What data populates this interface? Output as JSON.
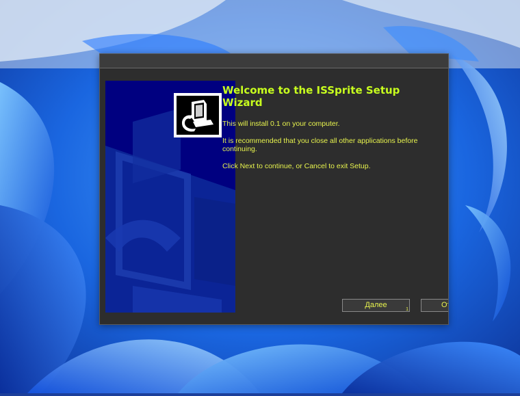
{
  "wizard": {
    "title": "Welcome to the ISSprite Setup Wizard",
    "paragraphs": [
      "This will install 0.1 on your computer.",
      "It is recommended that you close all other applications before continuing.",
      "Click Next to continue, or Cancel to exit Setup."
    ],
    "next_label": "Далее",
    "next_badge": "1",
    "cancel_label": "От"
  },
  "colors": {
    "accent_text": "#c8ff1e",
    "body_text": "#e8f44e",
    "banner": "#000080",
    "dialog_bg": "#2d2d2d"
  },
  "icons": {
    "wallpaper": "windows-11-bloom-wallpaper",
    "setup_logo": "installer-computer-icon"
  }
}
